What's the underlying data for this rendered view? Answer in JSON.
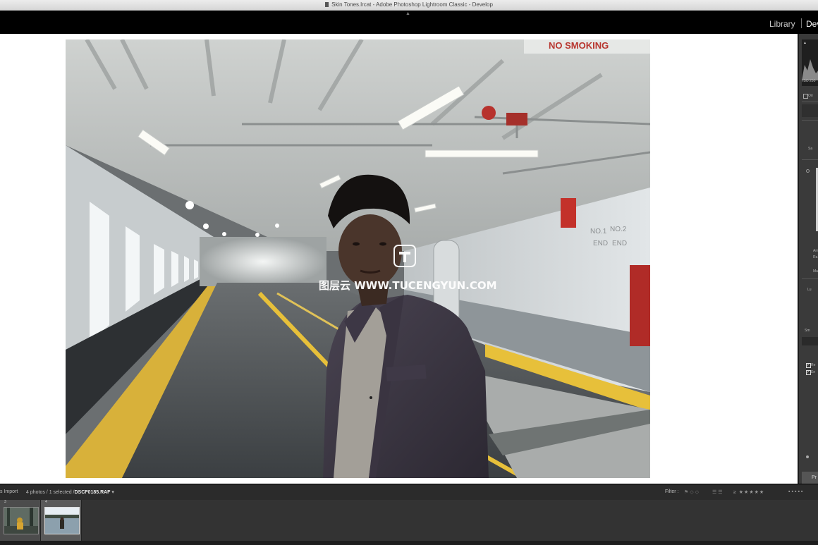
{
  "window": {
    "title": "Skin Tones.lrcat - Adobe Photoshop Lightroom Classic - Develop"
  },
  "modules": {
    "library": "Library",
    "develop": "Dev"
  },
  "photo": {
    "sign_text": "NO SMOKING",
    "wall_labels": [
      "NO.1",
      "NO.2",
      "END",
      "END"
    ]
  },
  "watermark": {
    "brand": "图层云 WWW.TUCENGYUN.COM"
  },
  "right_panel": {
    "histogram_info": "ISO 250",
    "original_photo_label": "Ori",
    "labels": [
      "Sa",
      "Am",
      "Ra",
      "Ma",
      "Lu",
      "Sm",
      "Re",
      "En",
      "Pr"
    ]
  },
  "filmstrip": {
    "import_label": "s Import",
    "count_label": "4 photos / 1 selected /",
    "filename": "DSCF0185.RAF",
    "filter_label": "Filter :",
    "thumbnails": [
      {
        "number": "3"
      },
      {
        "number": "4"
      }
    ]
  }
}
